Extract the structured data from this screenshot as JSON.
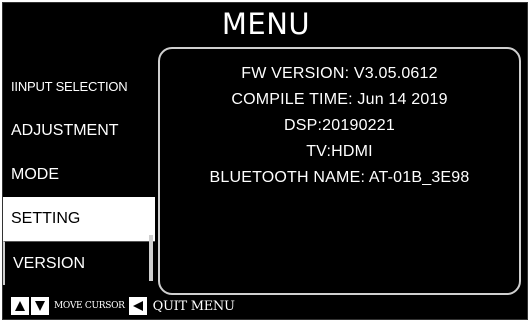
{
  "title": "MENU",
  "sidebar": {
    "items": [
      {
        "label": "IINPUT SELECTION"
      },
      {
        "label": "ADJUSTMENT"
      },
      {
        "label": "MODE"
      },
      {
        "label": "SETTING"
      },
      {
        "label": "VERSION"
      }
    ]
  },
  "info": {
    "fw_version": "FW VERSION: V3.05.0612",
    "compile_time": "COMPILE TIME: Jun 14 2019",
    "dsp": "DSP:20190221",
    "tv": "TV:HDMI",
    "bluetooth": "BLUETOOTH NAME: AT-01B_3E98"
  },
  "footer": {
    "move_cursor": "MOVE CURSOR",
    "quit_menu": "QUIT MENU"
  },
  "icons": {
    "up": "up-arrow-icon",
    "down": "down-arrow-icon",
    "left": "left-arrow-icon"
  }
}
